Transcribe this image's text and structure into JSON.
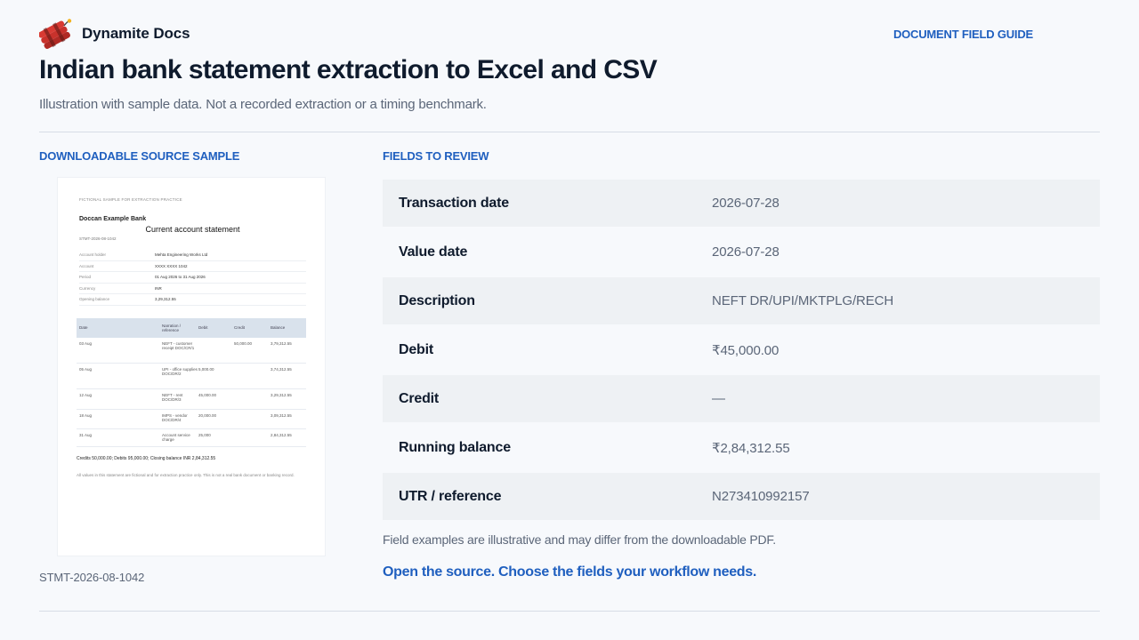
{
  "header": {
    "brand_name": "Dynamite Docs",
    "logo_icon": "dynamite-icon",
    "guide_link": "DOCUMENT FIELD GUIDE"
  },
  "page": {
    "title": "Indian bank statement extraction to Excel and CSV",
    "subtitle": "Illustration with sample data. Not a recorded extraction or a timing benchmark."
  },
  "source": {
    "heading": "DOWNLOADABLE SOURCE SAMPLE",
    "document_id": "STMT-2026-08-1042",
    "preview": {
      "banner": "FICTIONAL SAMPLE FOR EXTRACTION PRACTICE",
      "bank": "Doccan Example Bank",
      "title": "Current account statement",
      "ref": "STMT-2026-08-1042",
      "details": [
        {
          "key": "Account holder",
          "value": "Mehta Engineering Works Ltd"
        },
        {
          "key": "Account",
          "value": "XXXX XXXX 1042"
        },
        {
          "key": "Period",
          "value": "01 Aug 2026 to 31 Aug 2026"
        },
        {
          "key": "Currency",
          "value": "INR"
        },
        {
          "key": "Opening balance",
          "value": "3,29,312.55"
        }
      ],
      "columns": [
        "Date",
        "Narration / reference",
        "Debit",
        "Credit",
        "Balance"
      ],
      "rows": [
        {
          "date": "03 Aug",
          "narration": "NEFT - customer receipt DOC/CR/1",
          "debit": "",
          "credit": "50,000.00",
          "balance": "3,79,312.55"
        },
        {
          "date": "05 Aug",
          "narration": "UPI - office supplies DOC/DR/2",
          "debit": "5,000.00",
          "credit": "",
          "balance": "3,74,312.55"
        },
        {
          "date": "12 Aug",
          "narration": "NEFT - rent DOC/DR/3",
          "debit": "45,000.00",
          "credit": "",
          "balance": "3,29,312.55"
        },
        {
          "date": "18 Aug",
          "narration": "IMPS - vendor DOC/DR/4",
          "debit": "20,000.00",
          "credit": "",
          "balance": "3,09,312.55"
        },
        {
          "date": "31 Aug",
          "narration": "Account service charge",
          "debit": "25,000",
          "credit": "",
          "balance": "2,84,312.55"
        }
      ],
      "totals": "Credits 50,000.00; Debits 95,000.00; Closing balance INR 2,84,312.55",
      "footer": "All values in this statement are fictional and for extraction practice only. This is not a real bank document or banking record."
    }
  },
  "fields": {
    "heading": "FIELDS TO REVIEW",
    "items": [
      {
        "label": "Transaction date",
        "value": "2026-07-28"
      },
      {
        "label": "Value date",
        "value": "2026-07-28"
      },
      {
        "label": "Description",
        "value": "NEFT DR/UPI/MKTPLG/RECH"
      },
      {
        "label": "Debit",
        "value": "₹45,000.00"
      },
      {
        "label": "Credit",
        "value": "—"
      },
      {
        "label": "Running balance",
        "value": "₹2,84,312.55"
      },
      {
        "label": "UTR / reference",
        "value": "N273410992157"
      }
    ],
    "note": "Field examples are illustrative and may differ from the downloadable PDF.",
    "cta": "Open the source. Choose the fields your workflow needs."
  }
}
